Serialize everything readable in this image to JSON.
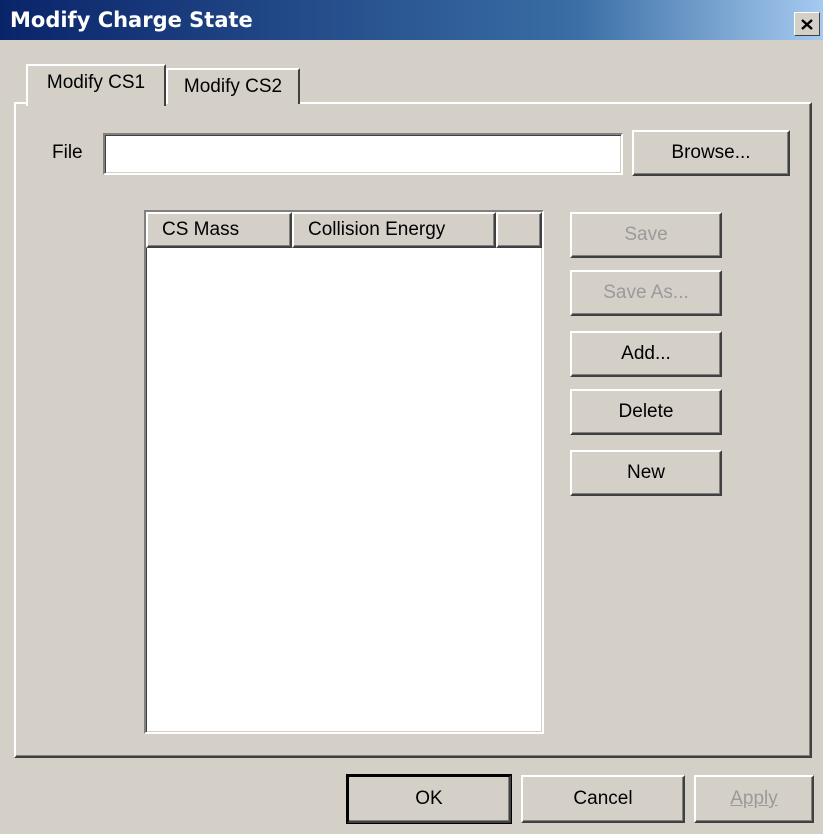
{
  "window": {
    "title": "Modify Charge State",
    "close_icon": "close-icon"
  },
  "tabs": [
    {
      "label": "Modify CS1",
      "active": true
    },
    {
      "label": "Modify CS2",
      "active": false
    }
  ],
  "file": {
    "label": "File",
    "value": "",
    "browse_label": "Browse..."
  },
  "list": {
    "columns": [
      "CS Mass",
      "Collision Energy",
      ""
    ],
    "rows": []
  },
  "side_buttons": {
    "save": {
      "label": "Save",
      "enabled": false
    },
    "save_as": {
      "label": "Save As...",
      "enabled": false
    },
    "add": {
      "label": "Add...",
      "enabled": true
    },
    "delete": {
      "label": "Delete",
      "enabled": true
    },
    "new": {
      "label": "New",
      "enabled": true
    }
  },
  "footer": {
    "ok": "OK",
    "cancel": "Cancel",
    "apply": "Apply",
    "apply_enabled": false
  }
}
